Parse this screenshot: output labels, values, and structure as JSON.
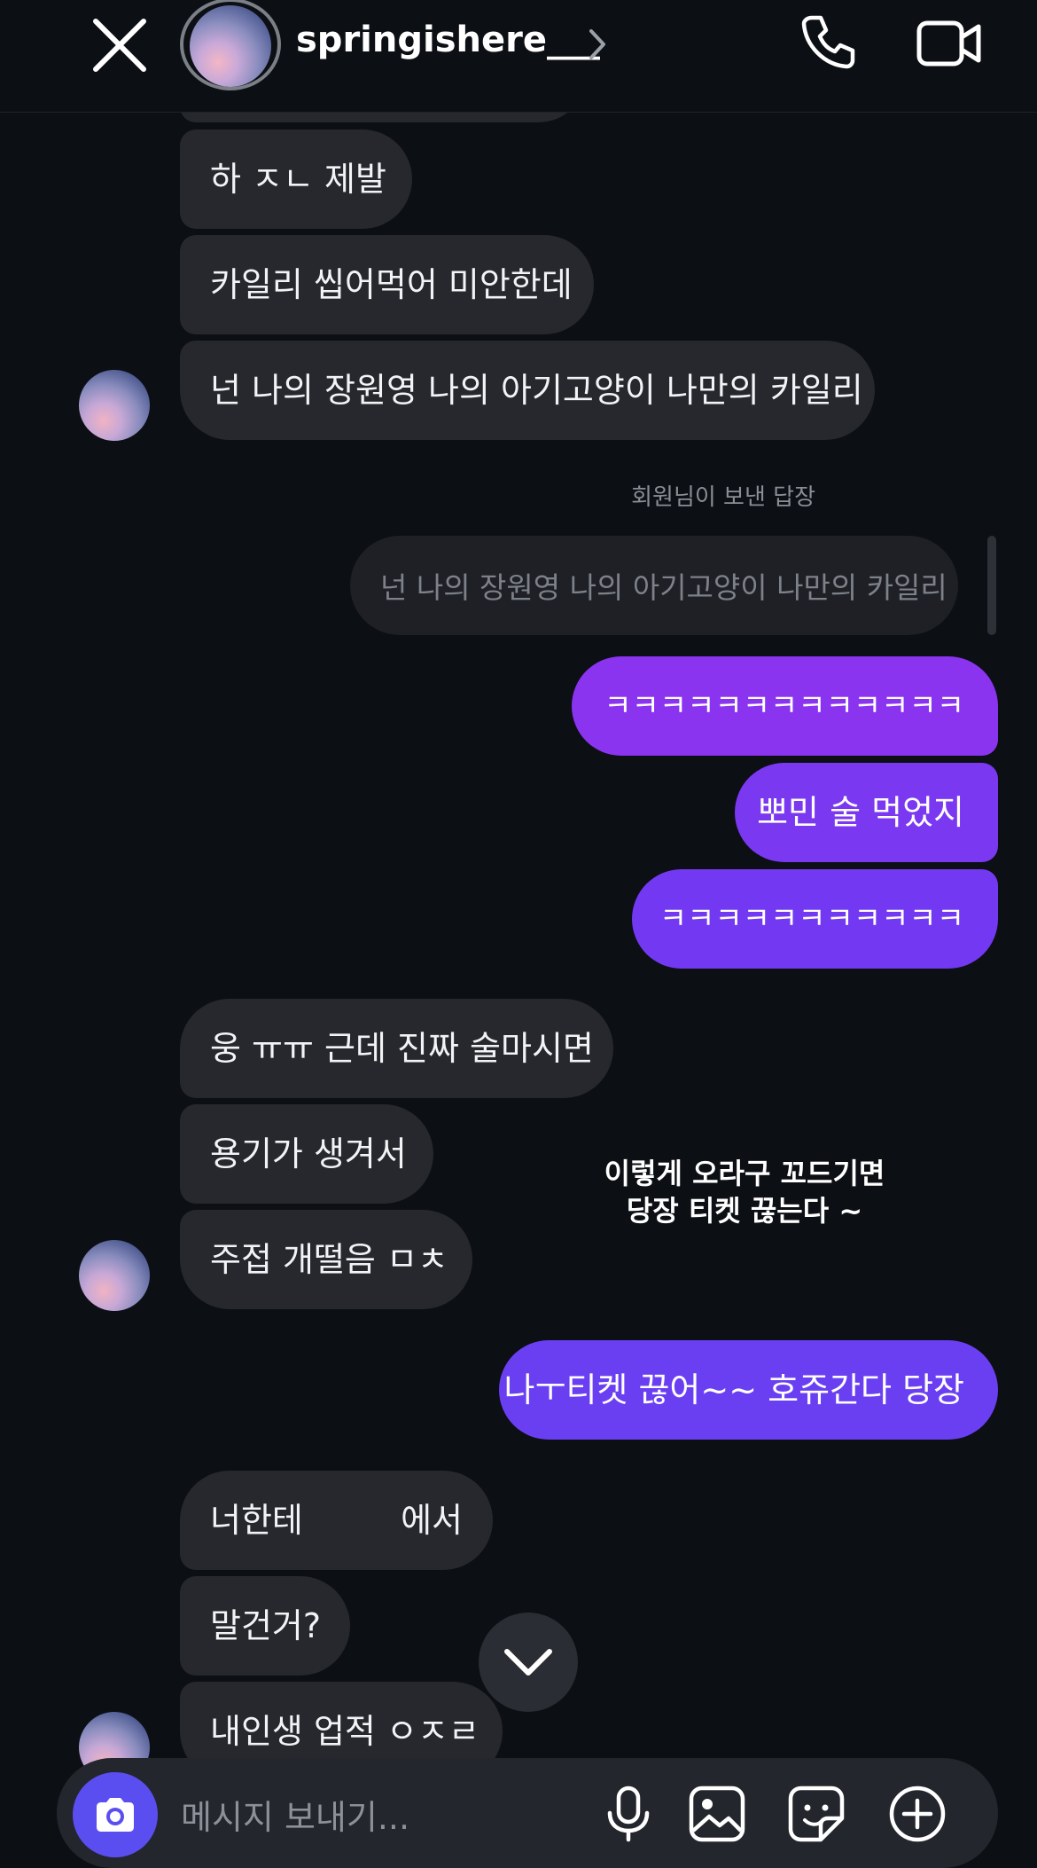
{
  "header": {
    "username": "springishere___"
  },
  "messages": {
    "in1": "하 ㅈㄴ 제발",
    "in2": "카일리 씹어먹어 미안한데",
    "in3": "넌 나의 장원영 나의 아기고양이 나만의 카일리",
    "reply_label": "회원님이 보낸 답장",
    "reply_quote": "넌 나의 장원영 나의 아기고양이 나만의 카일리",
    "out1": "ㅋㅋㅋㅋㅋㅋㅋㅋㅋㅋㅋㅋㅋ",
    "out2": "뽀민 술 먹었지",
    "out3": "ㅋㅋㅋㅋㅋㅋㅋㅋㅋㅋㅋ",
    "in4": "웅 ㅠㅠ 근데 진짜 술마시면",
    "in5": "용기가 생겨서",
    "in6": "주접 개떨음 ㅁㅊ",
    "out4": "나ㅜ티켓 끊어~~ 호쥬간다 당장",
    "in7": "너한테",
    "in7_suffix": "에서",
    "in8": "말건거?",
    "in9": "내인생 업적 ㅇㅈㄹ"
  },
  "caption": {
    "line1": "이렇게 오라구 꼬드기면",
    "line2": "당장 티켓 끊는다 ~"
  },
  "composer": {
    "placeholder": "메시지 보내기..."
  },
  "colors": {
    "background": "#0c0f14",
    "incoming_bubble": "#26282e",
    "outgoing_purple": "#8b34f0",
    "outgoing_indigo": "#6a3ff2",
    "camera_button": "#5b4ef0"
  },
  "icons": {
    "close": "close-icon",
    "chevron": "chevron-right-icon",
    "phone": "phone-icon",
    "video": "video-camera-icon",
    "scroll_down": "chevron-down-icon",
    "camera": "camera-icon",
    "mic": "microphone-icon",
    "gallery": "image-icon",
    "sticker": "sticker-icon",
    "plus": "plus-circle-icon"
  }
}
